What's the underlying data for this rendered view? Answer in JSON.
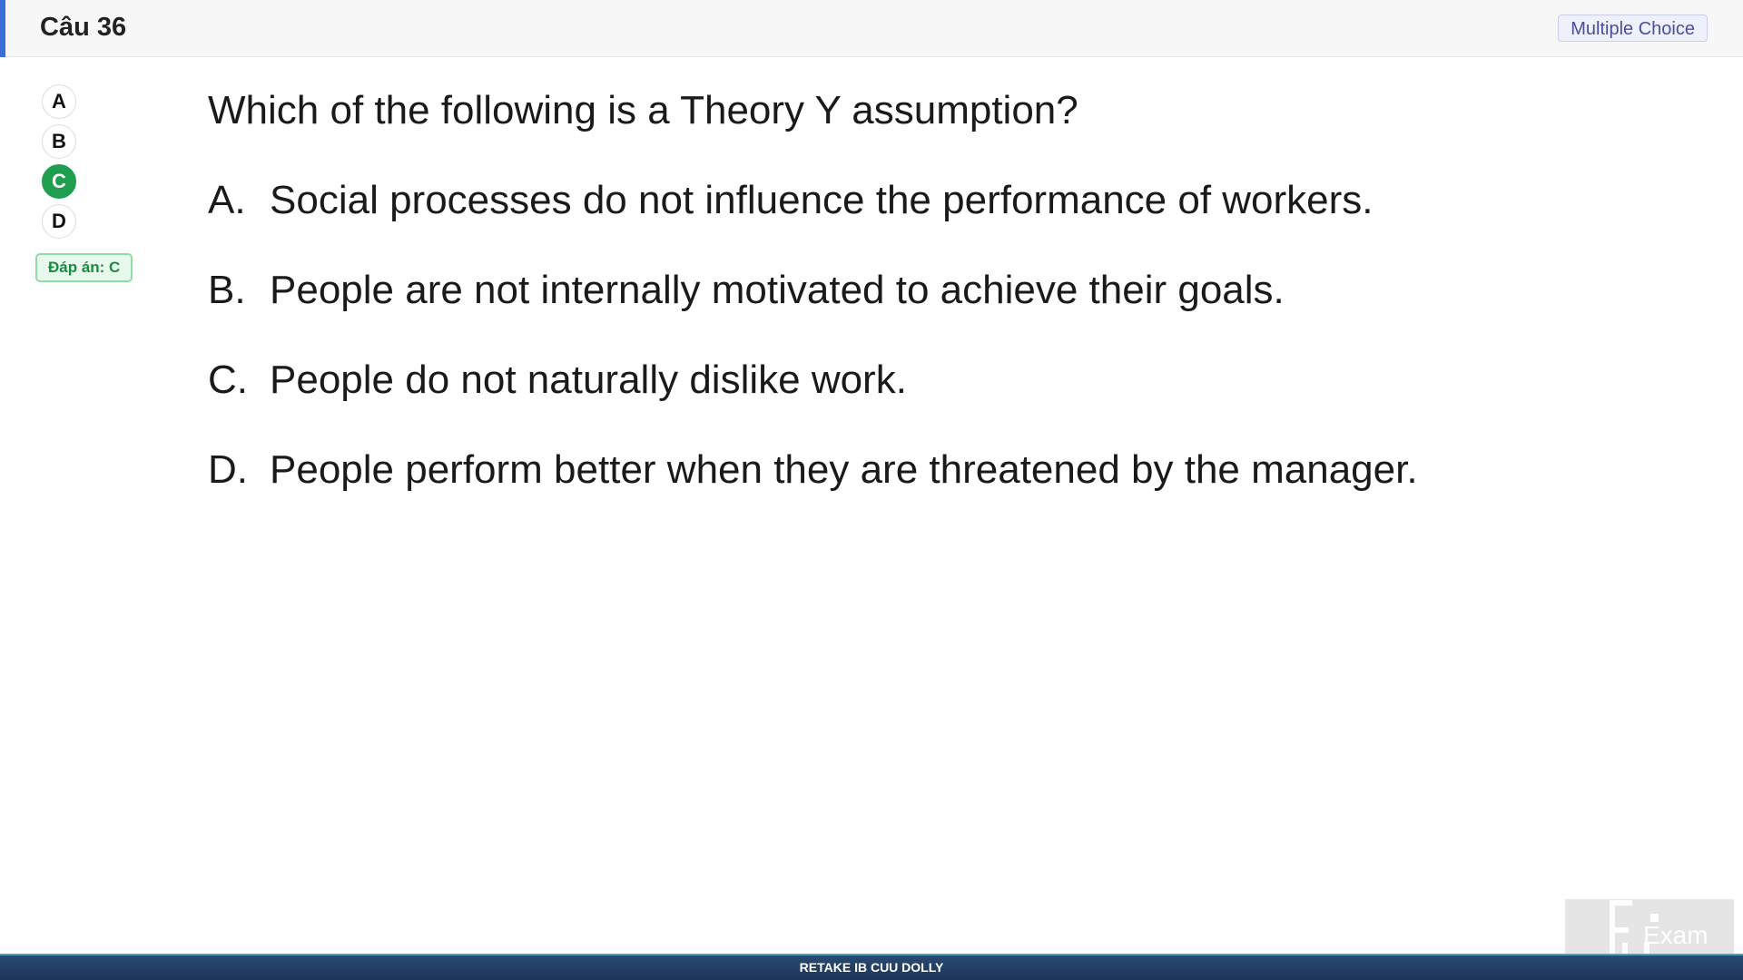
{
  "header": {
    "title": "Câu 36",
    "type_badge": "Multiple Choice",
    "accent_color": "#3b6fd6"
  },
  "options": [
    {
      "label": "A",
      "selected": false
    },
    {
      "label": "B",
      "selected": false
    },
    {
      "label": "C",
      "selected": true
    },
    {
      "label": "D",
      "selected": false
    }
  ],
  "answer_badge": "Đáp án: C",
  "question": {
    "stem": "Which of the following is a Theory Y assumption?",
    "choices": [
      {
        "letter": "A.",
        "text": "Social processes do not influence the performance of workers."
      },
      {
        "letter": "B.",
        "text": "People are not internally motivated to achieve their goals."
      },
      {
        "letter": "C.",
        "text": "People do not naturally dislike work."
      },
      {
        "letter": "D.",
        "text": "People perform better when they are threatened by the manager."
      }
    ]
  },
  "footer": {
    "text": "RETAKE IB CUU DOLLY"
  },
  "watermark": {
    "text": "Exam",
    "icon": "fu-logo-icon"
  },
  "colors": {
    "selected_option": "#1e9e4e",
    "answer_badge_bg": "#e8f8ec",
    "answer_badge_text": "#1d8a43",
    "footer_bg": "#1c3558"
  }
}
